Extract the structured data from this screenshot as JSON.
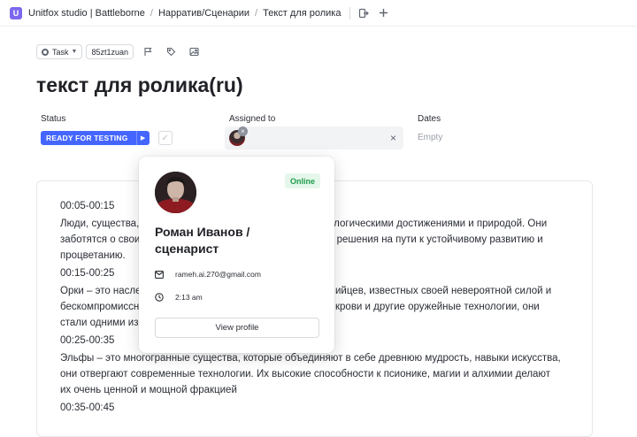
{
  "breadcrumb": {
    "workspace_initial": "U",
    "items": [
      "Unitfox studio | Battleborne",
      "Нарратив/Сценарии",
      "Текст для ролика"
    ],
    "separator": "/"
  },
  "task": {
    "type_label": "Task",
    "id": "85zt1zuan",
    "title": "текст для ролика(ru)"
  },
  "fields": {
    "status_label": "Status",
    "status_value": "READY FOR TESTING",
    "assigned_label": "Assigned to",
    "dates_label": "Dates",
    "dates_value": "Empty"
  },
  "description": {
    "lines": [
      "00:05-00:15",
      "Люди, существа,",
      "заботятся о свои",
      "процветанию.",
      "00:15-00:25",
      "Орки – это насле",
      "бескомпромиссн",
      "стали одними из",
      "00:25-00:35",
      "Эльфы – это многогранные существа, которые объединяют в себе древнюю мудрость, навыки искусства,",
      "они отвергают современные технологии. Их высокие способности к псионике, магии и алхимии делают",
      "их очень ценной и мощной фракцией",
      "00:35-00:45"
    ],
    "right_fragments": [
      "ологическими достижениями и природой. Они",
      "е решения на пути к устойчивому развитию и",
      "ийцев, известных своей невероятной силой и",
      "крови и другие оружейные технологии, они"
    ]
  },
  "popup": {
    "status_badge": "Online",
    "name": "Роман Иванов / сценарист",
    "email": "rameh.ai.270@gmail.com",
    "local_time": "2:13 am",
    "view_profile_label": "View profile"
  },
  "colors": {
    "status_blue": "#4466ff",
    "online_green": "#1f9d4c",
    "workspace_purple": "#7b68ee"
  }
}
